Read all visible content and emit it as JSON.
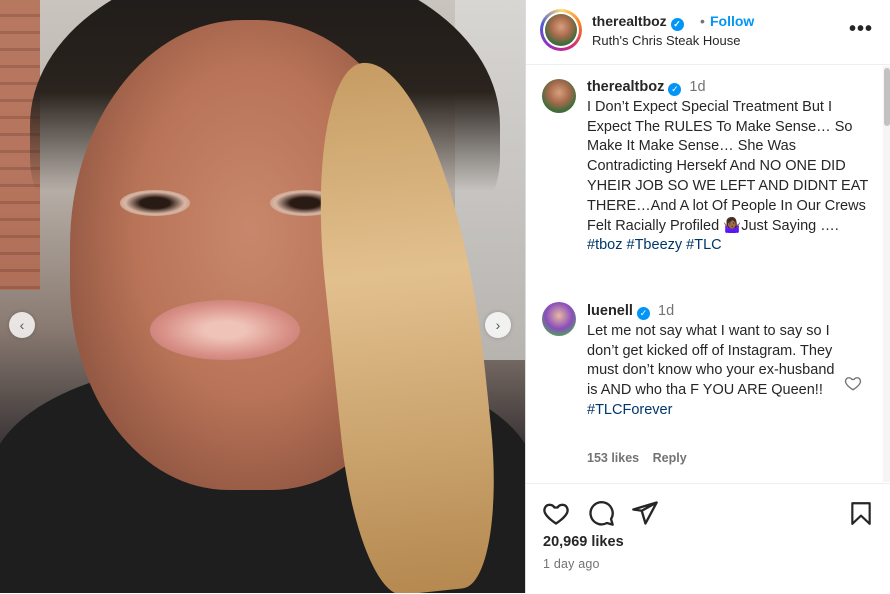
{
  "post": {
    "username": "therealtboz",
    "follow_label": "Follow",
    "dot": "•",
    "location": "Ruth's Chris Steak House",
    "more_label": "•••",
    "nav_prev": "‹",
    "nav_next": "›"
  },
  "caption": {
    "username": "therealtboz",
    "time": "1d",
    "text": "I Don’t Expect Special Treatment But I Expect The RULES To Make Sense… So Make It Make Sense… She Was Contradicting Hersekf And NO ONE DID YHEIR JOB SO WE LEFT AND DIDNT EAT THERE…And A lot Of People In Our Crews Felt Racially Profiled 🤷🏾‍♀️Just Saying …. ",
    "tags": [
      "#tboz",
      "#Tbeezy",
      "#TLC"
    ]
  },
  "comment": {
    "username": "luenell",
    "time": "1d",
    "text": "Let me not say what I want to say so I don’t get kicked off of Instagram. They must don’t know who your ex-husband is AND who tha F YOU ARE Queen!! ",
    "tag": "#TLCForever",
    "likes": "153 likes",
    "reply_label": "Reply"
  },
  "footer": {
    "likes": "20,969 likes",
    "ago": "1 day ago"
  },
  "icons": [
    "like-icon",
    "comment-icon",
    "share-icon",
    "save-icon",
    "verified-icon",
    "more-icon",
    "chevron-left-icon",
    "chevron-right-icon"
  ],
  "colors": {
    "accent": "#0095f6",
    "hashtag": "#00376b",
    "muted": "#737373"
  }
}
